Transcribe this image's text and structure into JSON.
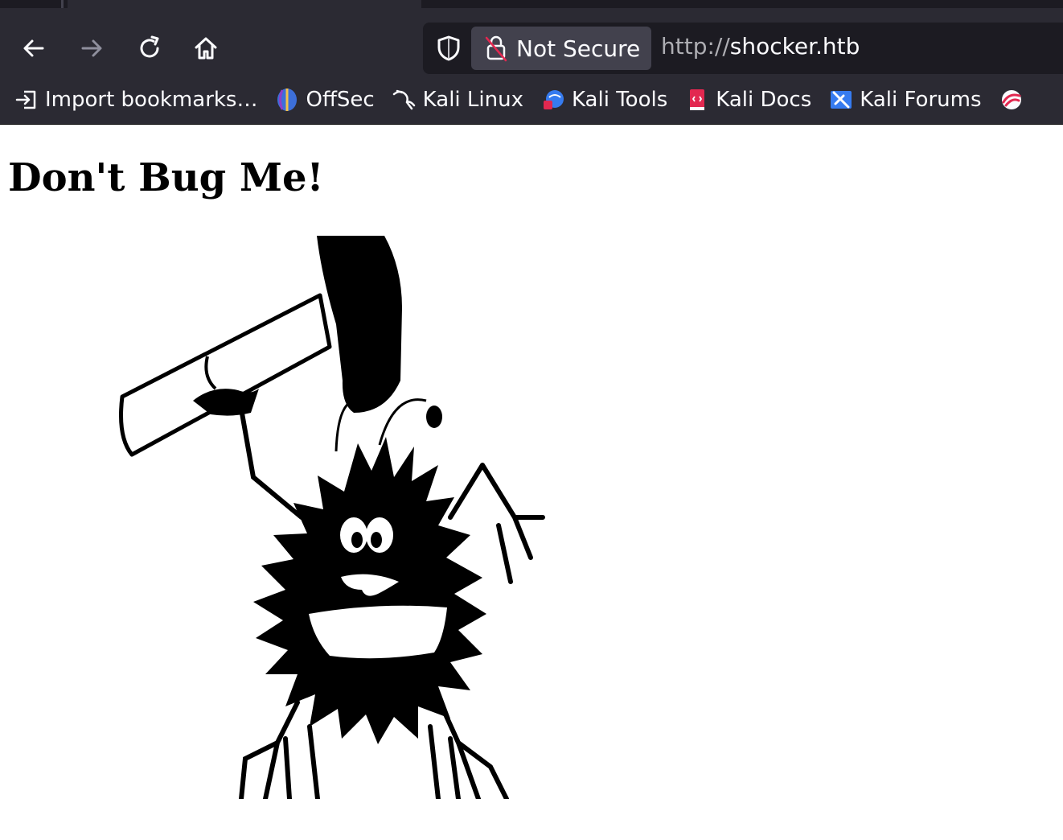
{
  "browser": {
    "nav": {
      "back_icon": "arrow-left-icon",
      "forward_icon": "arrow-right-icon",
      "reload_icon": "reload-icon",
      "home_icon": "home-icon"
    },
    "urlbar": {
      "security_label": "Not Secure",
      "url_scheme": "http://",
      "url_host": "shocker.htb"
    },
    "bookmarks": [
      {
        "label": "Import bookmarks…",
        "icon": "import-icon"
      },
      {
        "label": "OffSec",
        "icon": "offsec-icon"
      },
      {
        "label": "Kali Linux",
        "icon": "kali-dragon-icon"
      },
      {
        "label": "Kali Tools",
        "icon": "kali-tools-icon"
      },
      {
        "label": "Kali Docs",
        "icon": "kali-docs-icon"
      },
      {
        "label": "Kali Forums",
        "icon": "kali-forums-icon"
      },
      {
        "label": "",
        "icon": "kali-nethunter-icon"
      }
    ]
  },
  "page": {
    "heading": "Don't Bug Me!"
  }
}
